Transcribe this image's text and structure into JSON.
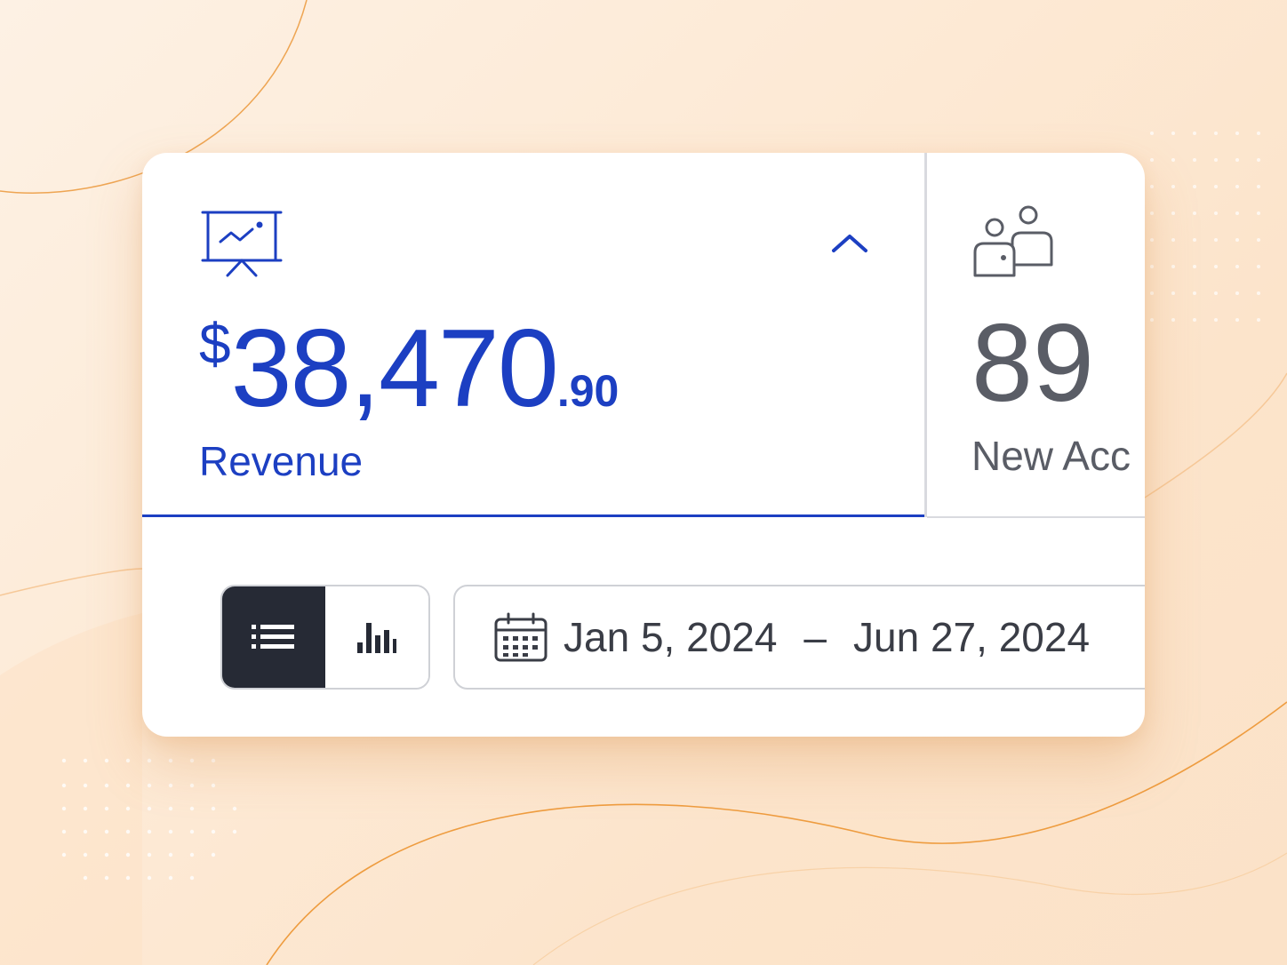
{
  "revenue": {
    "currency": "$",
    "integer": "38,470",
    "cents": ".90",
    "label": "Revenue",
    "icon": "presentation-chart-icon",
    "expanded_indicator": "chevron-up-icon"
  },
  "new_accounts": {
    "value": "89",
    "label": "New Acc",
    "icon": "users-icon"
  },
  "view_toggle": {
    "options": [
      "list-icon",
      "bar-chart-icon"
    ],
    "selected": "list"
  },
  "date_range": {
    "start": "Jan 5, 2024",
    "separator": "–",
    "end": "Jun 27, 2024",
    "icon": "calendar-icon"
  },
  "colors": {
    "accent": "#1c3fc2",
    "muted_text": "#5a5d66",
    "dark_toggle": "#262a35",
    "background": "#fde9d4"
  }
}
